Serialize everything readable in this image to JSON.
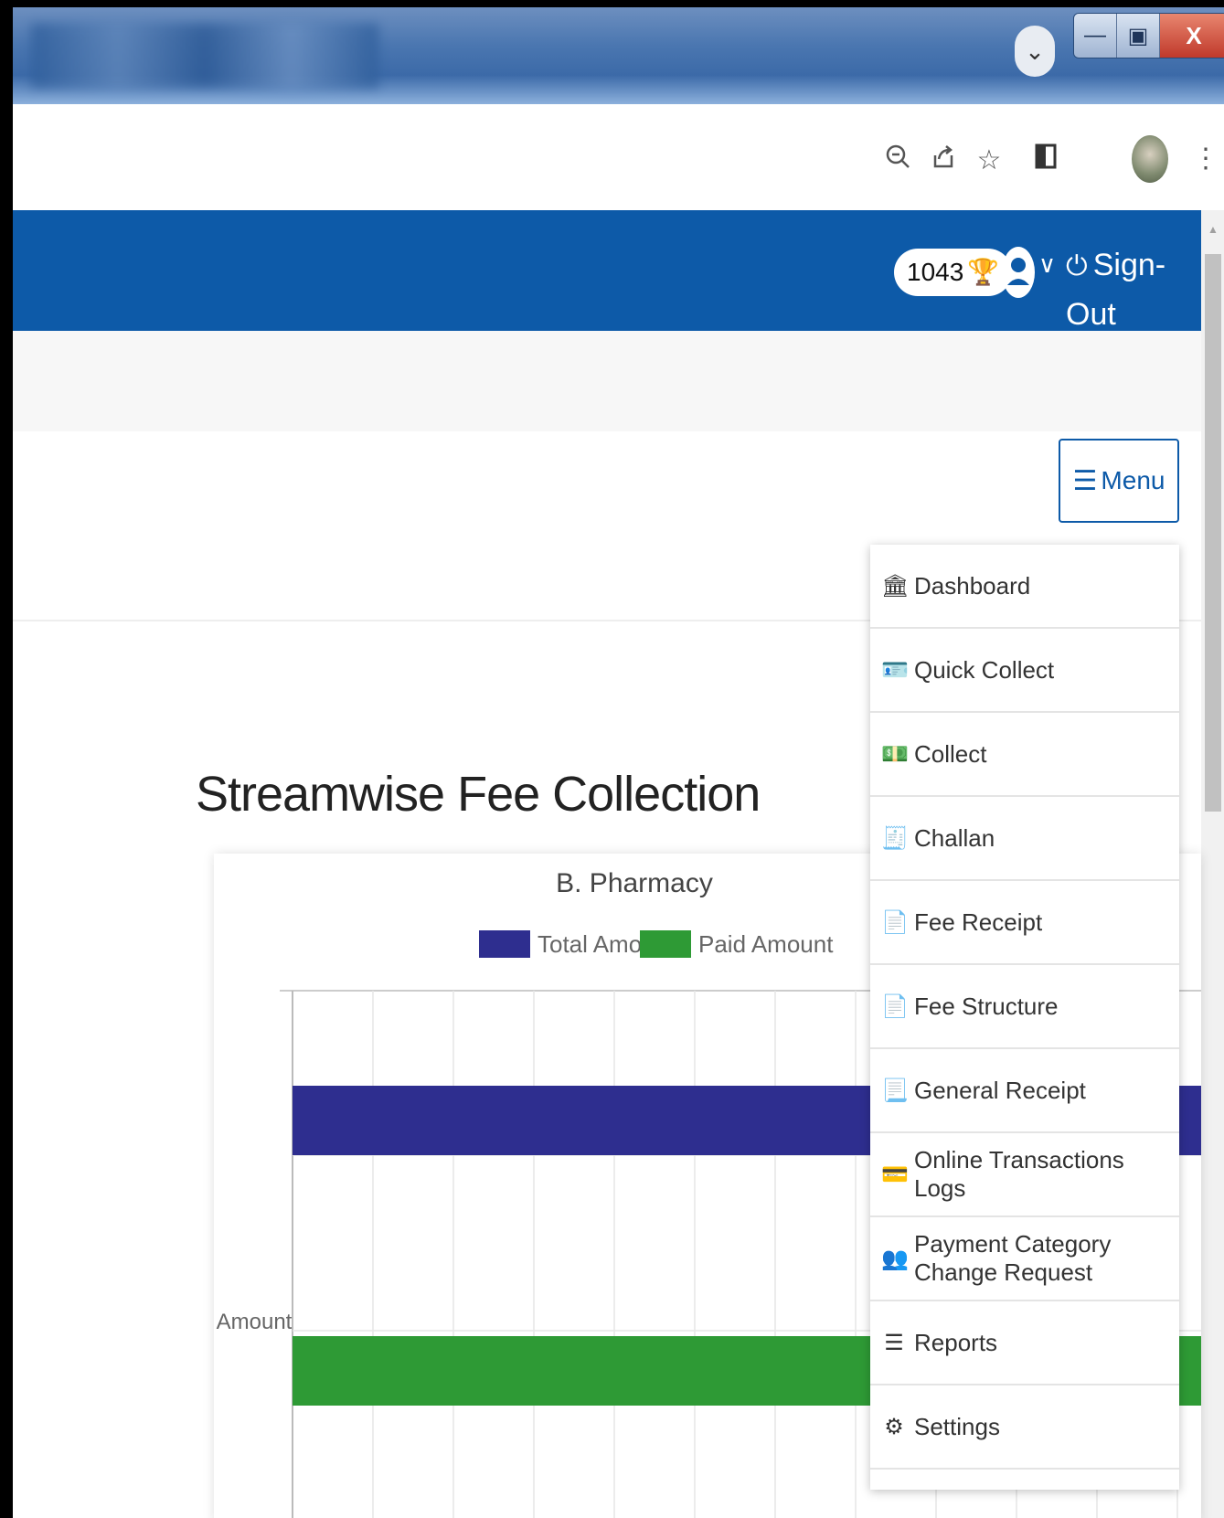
{
  "window": {
    "tab_search_icon": "chevron-down-icon",
    "minimize_label": "—",
    "restore_label": "▣",
    "close_label": "X"
  },
  "browser_toolbar": {
    "icons": [
      "zoom-icon",
      "share-icon",
      "star-icon",
      "side-panel-icon",
      "profile-avatar",
      "kebab-menu-icon"
    ]
  },
  "header": {
    "points": "1043",
    "signout_label": "Sign-Out",
    "colors": {
      "primary": "#0d5aa8"
    }
  },
  "menu": {
    "button_label": "Menu",
    "items": [
      {
        "label": "Dashboard",
        "icon": "bank-icon"
      },
      {
        "label": "Quick Collect",
        "icon": "id-card-icon"
      },
      {
        "label": "Collect",
        "icon": "money-icon"
      },
      {
        "label": "Challan",
        "icon": "receipt-icon"
      },
      {
        "label": "Fee Receipt",
        "icon": "file-icon"
      },
      {
        "label": "Fee Structure",
        "icon": "file-icon"
      },
      {
        "label": "General Receipt",
        "icon": "document-icon"
      },
      {
        "label": "Online Transactions Logs",
        "icon": "credit-card-icon"
      },
      {
        "label": "Payment Category Change Request",
        "icon": "users-icon"
      },
      {
        "label": "Reports",
        "icon": "list-icon"
      },
      {
        "label": "Settings",
        "icon": "gear-icon"
      }
    ]
  },
  "page": {
    "section_title": "Streamwise Fee Collection"
  },
  "chart_data": {
    "type": "bar",
    "orientation": "horizontal",
    "title": "B. Pharmacy",
    "ylabel": "Amount",
    "legend_position": "top",
    "grid": true,
    "series": [
      {
        "name": "Total Amount",
        "color": "#2e2e8f"
      },
      {
        "name": "Paid Amount",
        "color": "#2e9a35"
      }
    ]
  }
}
